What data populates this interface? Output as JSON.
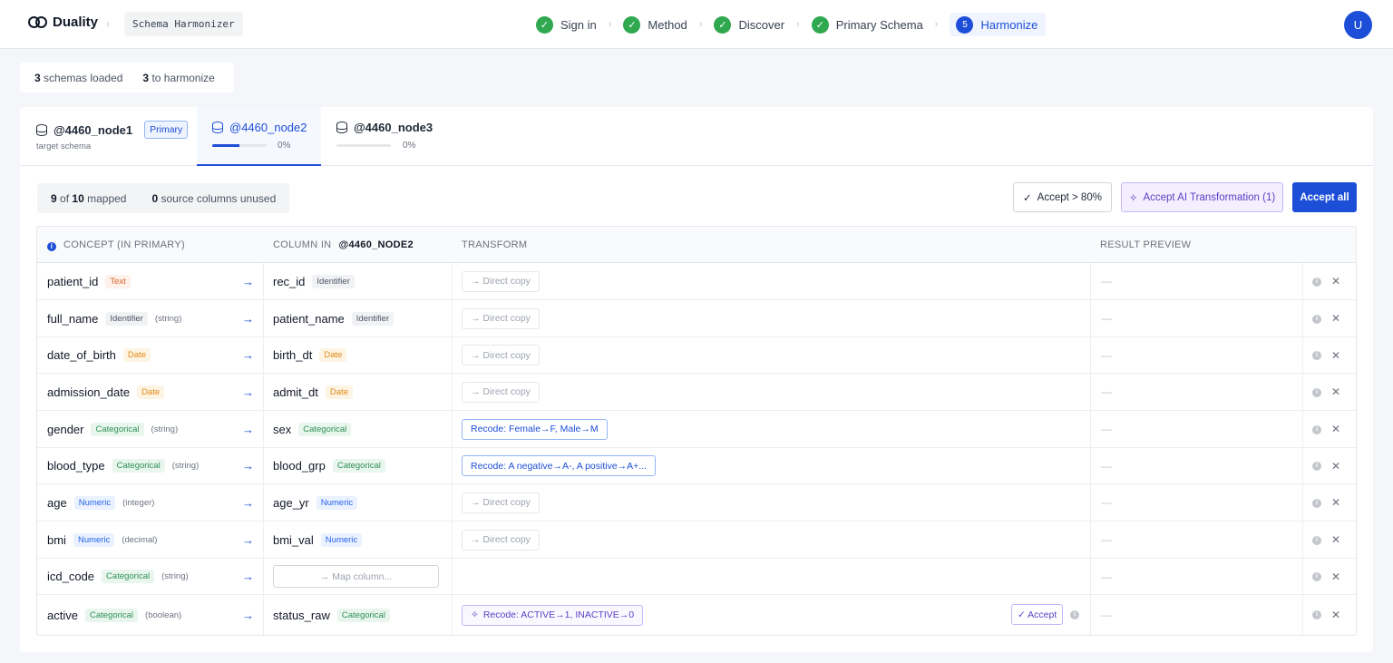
{
  "header": {
    "logo_text": "Duality",
    "crumb_separator": "›",
    "app_name": "Schema Harmonizer",
    "steps": [
      {
        "label": "Sign in",
        "status": "done",
        "icon": "check-icon"
      },
      {
        "label": "Method",
        "status": "done",
        "icon": "check-icon"
      },
      {
        "label": "Discover",
        "status": "done",
        "icon": "check-icon"
      },
      {
        "label": "Primary Schema",
        "status": "done",
        "icon": "check-icon"
      },
      {
        "label": "Harmonize",
        "status": "current",
        "number": "5"
      }
    ],
    "step_separator": "›",
    "avatar_initial": "U"
  },
  "summary": {
    "schemas_loaded_count": "3",
    "schemas_loaded_label": "schemas loaded",
    "to_harmonize_count": "3",
    "to_harmonize_label": "to harmonize"
  },
  "tabs": [
    {
      "label": "@4460_node1",
      "badge": "Primary",
      "sub": "target schema",
      "icon": "database-icon"
    },
    {
      "label": "@4460_node2",
      "progress_label": "0%",
      "progress": 0.5,
      "active": true,
      "icon": "database-icon"
    },
    {
      "label": "@4460_node3",
      "progress_label": "0%",
      "progress": 0,
      "icon": "database-icon"
    }
  ],
  "mapping_status": {
    "mapped_count": "9",
    "of_label": "of",
    "total": "10",
    "mapped_label": "mapped",
    "unused_count": "0",
    "unused_label": "source columns unused"
  },
  "actions": {
    "accept_threshold": "Accept > 80%",
    "accept_ai": "Accept AI Transformation (1)",
    "accept_all": "Accept all"
  },
  "table": {
    "headers": {
      "concept": "CONCEPT (IN PRIMARY)",
      "column_in": "COLUMN IN",
      "column_node": "@4460_NODE2",
      "transform": "TRANSFORM",
      "result_preview": "RESULT PREVIEW"
    },
    "rows": [
      {
        "concept": "patient_id",
        "concept_type": "Text",
        "concept_dtype": "",
        "column": "rec_id",
        "column_type": "Identifier",
        "transform": "→ Direct copy",
        "transform_kind": "copy",
        "preview": "—"
      },
      {
        "concept": "full_name",
        "concept_type": "Identifier",
        "concept_dtype": "(string)",
        "column": "patient_name",
        "column_type": "Identifier",
        "transform": "→ Direct copy",
        "transform_kind": "copy",
        "preview": "—"
      },
      {
        "concept": "date_of_birth",
        "concept_type": "Date",
        "concept_dtype": "",
        "column": "birth_dt",
        "column_type": "Date",
        "transform": "→ Direct copy",
        "transform_kind": "copy",
        "preview": "—"
      },
      {
        "concept": "admission_date",
        "concept_type": "Date",
        "concept_dtype": "",
        "column": "admit_dt",
        "column_type": "Date",
        "transform": "→ Direct copy",
        "transform_kind": "copy",
        "preview": "—"
      },
      {
        "concept": "gender",
        "concept_type": "Categorical",
        "concept_dtype": "(string)",
        "column": "sex",
        "column_type": "Categorical",
        "transform": "Recode: Female→F, Male→M",
        "transform_kind": "recode",
        "preview": "—"
      },
      {
        "concept": "blood_type",
        "concept_type": "Categorical",
        "concept_dtype": "(string)",
        "column": "blood_grp",
        "column_type": "Categorical",
        "transform": "Recode: A negative→A-, A positive→A+...",
        "transform_kind": "recode",
        "preview": "—"
      },
      {
        "concept": "age",
        "concept_type": "Numeric",
        "concept_dtype": "(integer)",
        "column": "age_yr",
        "column_type": "Numeric",
        "transform": "→ Direct copy",
        "transform_kind": "copy",
        "preview": "—"
      },
      {
        "concept": "bmi",
        "concept_type": "Numeric",
        "concept_dtype": "(decimal)",
        "column": "bmi_val",
        "column_type": "Numeric",
        "transform": "→ Direct copy",
        "transform_kind": "copy",
        "preview": "—"
      },
      {
        "concept": "icd_code",
        "concept_type": "Categorical",
        "concept_dtype": "(string)",
        "column": "",
        "map_placeholder": "→ Map column...",
        "transform": "",
        "transform_kind": "none",
        "preview": "—"
      },
      {
        "concept": "active",
        "concept_type": "Categorical",
        "concept_dtype": "(boolean)",
        "column": "status_raw",
        "column_type": "Categorical",
        "transform": "Recode: ACTIVE→1, INACTIVE→0",
        "transform_kind": "ai",
        "accept_label": "✓ Accept",
        "preview": "—"
      }
    ],
    "row_action_icons": [
      "info-icon",
      "close-icon"
    ]
  },
  "colors": {
    "accent": "#1d4ed8",
    "done_green": "#2fa84f",
    "ai_purple": "#5b3fc4"
  }
}
